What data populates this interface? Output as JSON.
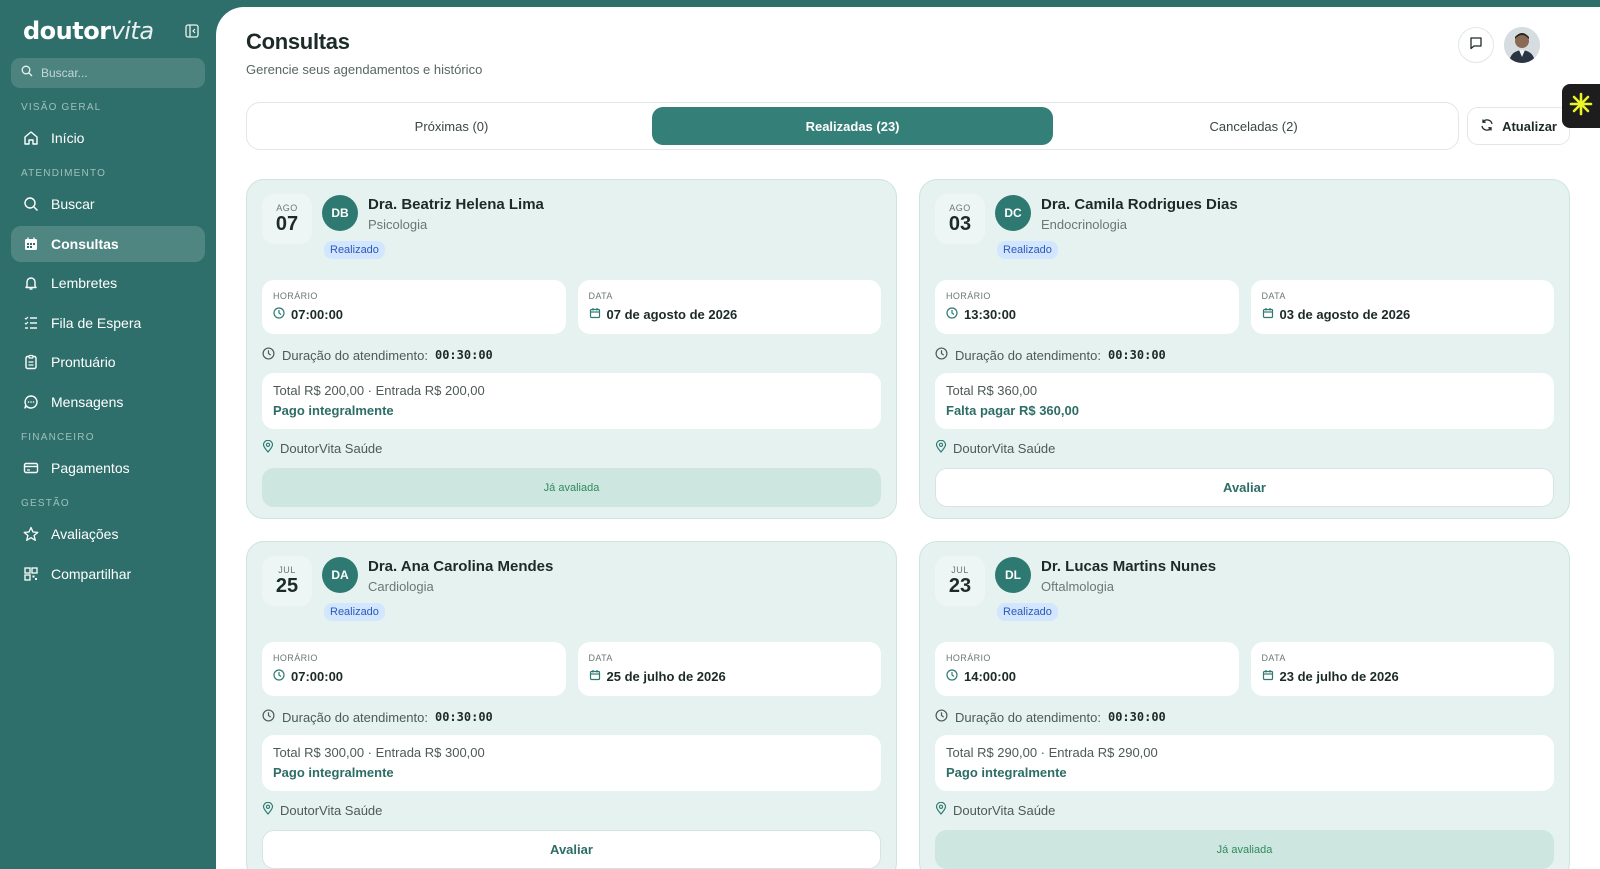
{
  "brand": {
    "logo_bold": "doutor",
    "logo_light": "vita"
  },
  "search": {
    "placeholder": "Buscar..."
  },
  "nav": {
    "sections": [
      {
        "title": "VISÃO GERAL"
      },
      {
        "title": "ATENDIMENTO"
      },
      {
        "title": "FINANCEIRO"
      },
      {
        "title": "GESTÃO"
      }
    ],
    "items": [
      {
        "label": "Início",
        "icon": "home-icon"
      },
      {
        "label": "Buscar",
        "icon": "search-icon"
      },
      {
        "label": "Consultas",
        "icon": "calendar-icon",
        "active": true
      },
      {
        "label": "Lembretes",
        "icon": "bell-icon"
      },
      {
        "label": "Fila de Espera",
        "icon": "list-icon"
      },
      {
        "label": "Prontuário",
        "icon": "clipboard-icon"
      },
      {
        "label": "Mensagens",
        "icon": "message-icon"
      },
      {
        "label": "Pagamentos",
        "icon": "credit-card-icon"
      },
      {
        "label": "Avaliações",
        "icon": "star-icon"
      },
      {
        "label": "Compartilhar",
        "icon": "qr-code-icon"
      }
    ]
  },
  "header": {
    "title": "Consultas",
    "subtitle": "Gerencie seus agendamentos e histórico"
  },
  "tabs": [
    {
      "label": "Próximas (0)"
    },
    {
      "label": "Realizadas (23)",
      "active": true
    },
    {
      "label": "Canceladas (2)"
    }
  ],
  "refresh_label": "Atualizar",
  "labels": {
    "time": "HORÁRIO",
    "date": "DATA",
    "duration": "Duração do atendimento:"
  },
  "appointments": [
    {
      "month": "AGO",
      "day": "07",
      "initials": "DB",
      "doctor": "Dra. Beatriz Helena Lima",
      "specialty": "Psicologia",
      "status": "Realizado",
      "time": "07:00:00",
      "date": "07 de agosto de 2026",
      "duration": "00:30:00",
      "payment_total": "Total R$ 200,00 · Entrada R$ 200,00",
      "payment_status": "Pago integralmente",
      "location": "DoutorVita Saúde",
      "action": "Já avaliada",
      "rated": true
    },
    {
      "month": "AGO",
      "day": "03",
      "initials": "DC",
      "doctor": "Dra. Camila Rodrigues Dias",
      "specialty": "Endocrinologia",
      "status": "Realizado",
      "time": "13:30:00",
      "date": "03 de agosto de 2026",
      "duration": "00:30:00",
      "payment_total": "Total R$ 360,00",
      "payment_status": "Falta pagar R$ 360,00",
      "location": "DoutorVita Saúde",
      "action": "Avaliar",
      "rated": false
    },
    {
      "month": "JUL",
      "day": "25",
      "initials": "DA",
      "doctor": "Dra. Ana Carolina Mendes",
      "specialty": "Cardiologia",
      "status": "Realizado",
      "time": "07:00:00",
      "date": "25 de julho de 2026",
      "duration": "00:30:00",
      "payment_total": "Total R$ 300,00 · Entrada R$ 300,00",
      "payment_status": "Pago integralmente",
      "location": "DoutorVita Saúde",
      "action": "Avaliar",
      "rated": false
    },
    {
      "month": "JUL",
      "day": "23",
      "initials": "DL",
      "doctor": "Dr. Lucas Martins Nunes",
      "specialty": "Oftalmologia",
      "status": "Realizado",
      "time": "14:00:00",
      "date": "23 de julho de 2026",
      "duration": "00:30:00",
      "payment_total": "Total R$ 290,00 · Entrada R$ 290,00",
      "payment_status": "Pago integralmente",
      "location": "DoutorVita Saúde",
      "action": "Já avaliada",
      "rated": true
    }
  ]
}
